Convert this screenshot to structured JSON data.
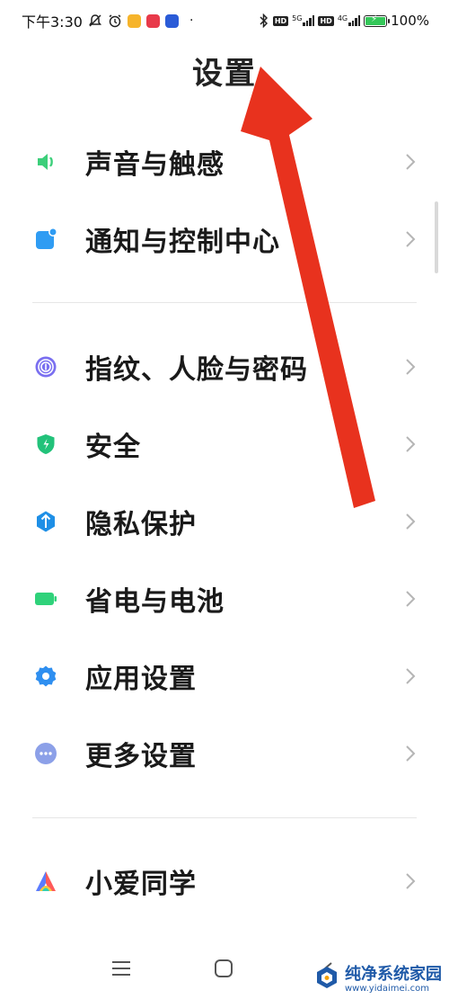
{
  "status_bar": {
    "time": "下午3:30",
    "network_1": "5G",
    "network_2": "4G",
    "hd_1": "HD",
    "hd_2": "HD",
    "battery_percent": "100%",
    "battery_level": 1.0
  },
  "header": {
    "title": "设置"
  },
  "settings": {
    "items": [
      {
        "label": "声音与触感",
        "icon": "speaker-icon",
        "color": "#3ccf7a"
      },
      {
        "label": "通知与控制中心",
        "icon": "notification-icon",
        "color": "#2f9cf3"
      },
      {
        "label": "指纹、人脸与密码",
        "icon": "fingerprint-icon",
        "color": "#7a6ff0"
      },
      {
        "label": "安全",
        "icon": "shield-icon",
        "color": "#22c27a"
      },
      {
        "label": "隐私保护",
        "icon": "privacy-icon",
        "color": "#1e8fe6"
      },
      {
        "label": "省电与电池",
        "icon": "battery-icon",
        "color": "#2fd27a"
      },
      {
        "label": "应用设置",
        "icon": "app-settings-gear-icon",
        "color": "#2f8ff0"
      },
      {
        "label": "更多设置",
        "icon": "more-dots-icon",
        "color": "#8ca0e8"
      },
      {
        "label": "小爱同学",
        "icon": "xiaoai-icon",
        "color": "#ff5a5a"
      }
    ]
  },
  "bottom_nav": {
    "menu": "menu-icon",
    "home": "home-icon",
    "back": "back-icon"
  },
  "watermark": {
    "main": "纯净系统家园",
    "sub": "www.yidaimei.com"
  },
  "colors": {
    "annotation_arrow": "#e8321e",
    "chevron": "#b5b5b5",
    "divider": "#e6e6e6"
  }
}
